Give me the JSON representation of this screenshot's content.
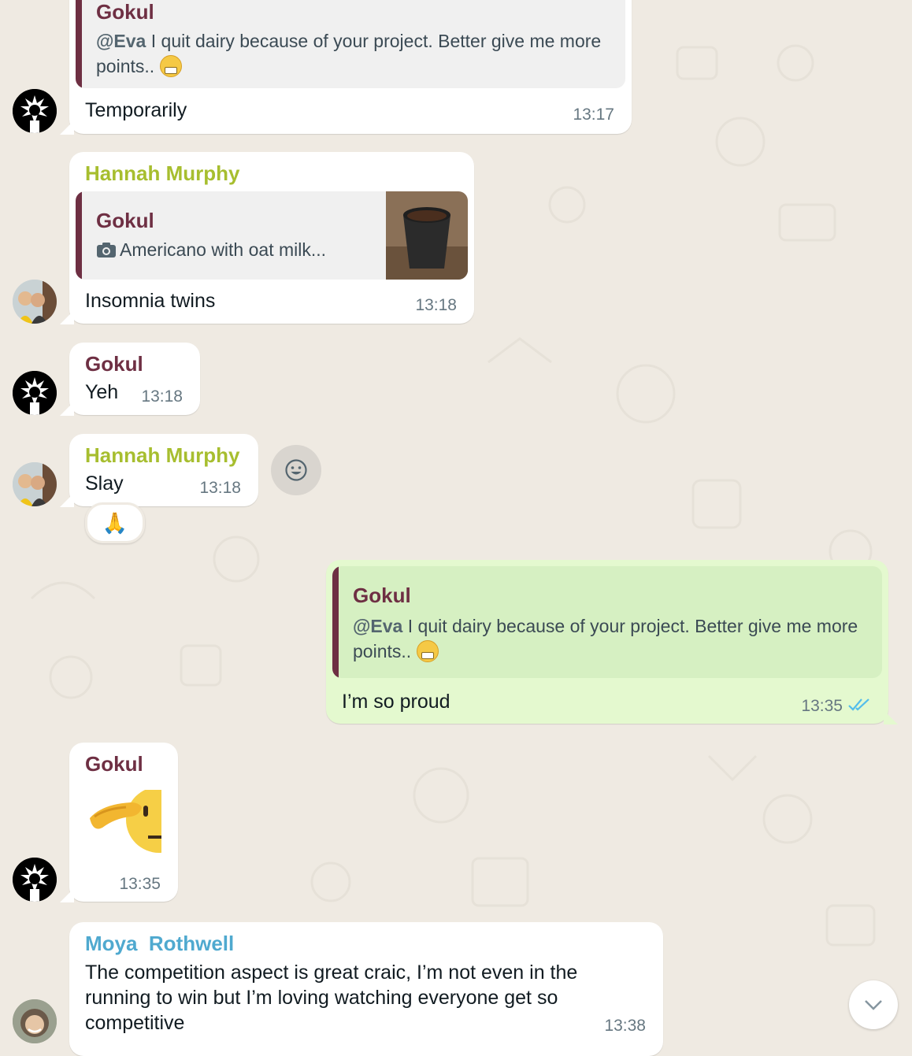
{
  "colors": {
    "chat_background": "#efeae2",
    "incoming_bubble": "#ffffff",
    "outgoing_bubble": "#e4f9cf",
    "gokul_name": "#6e2f43",
    "hannah_name": "#a7be2f",
    "moya_name": "#4fa9cf",
    "read_ticks": "#53bdeb",
    "timestamp": "#667781"
  },
  "messages": [
    {
      "id": "m1",
      "quote": {
        "sender": "Gokul",
        "mention": "@Eva",
        "text": " I quit dairy because of your project. Better give me more points.."
      },
      "body": "Temporarily",
      "time": "13:17",
      "avatar_icon": "gokul-avatar-icon"
    },
    {
      "id": "m2",
      "sender": "Hannah Murphy",
      "quote": {
        "sender": "Gokul",
        "text": "Americano with oat milk...",
        "icon": "camera-icon",
        "thumbnail": "coffee-cup-photo"
      },
      "body": "Insomnia twins",
      "time": "13:18"
    },
    {
      "id": "m3",
      "sender": "Gokul",
      "body": "Yeh",
      "time": "13:18"
    },
    {
      "id": "m4",
      "sender": "Hannah Murphy",
      "body": "Slay",
      "time": "13:18",
      "reaction": "🙏",
      "react_icon": "smiley-icon"
    },
    {
      "id": "m5",
      "outgoing": true,
      "quote": {
        "sender": "Gokul",
        "mention": "@Eva",
        "text": " I quit dairy because of your project. Better give me more points.."
      },
      "body": "I’m so proud",
      "time": "13:35",
      "status_icon": "double-check-icon"
    },
    {
      "id": "m6",
      "sender": "Gokul",
      "sticker": "saluting-face-sticker",
      "time": "13:35"
    },
    {
      "id": "m7",
      "sender": "Moya  Rothwell",
      "body_lines": [
        "The competition aspect is great craic, I’m not even in the",
        "running to win but I’m loving watching everyone get so",
        "competitive"
      ],
      "time": "13:38"
    }
  ],
  "scroll_button_icon": "chevron-down-icon"
}
